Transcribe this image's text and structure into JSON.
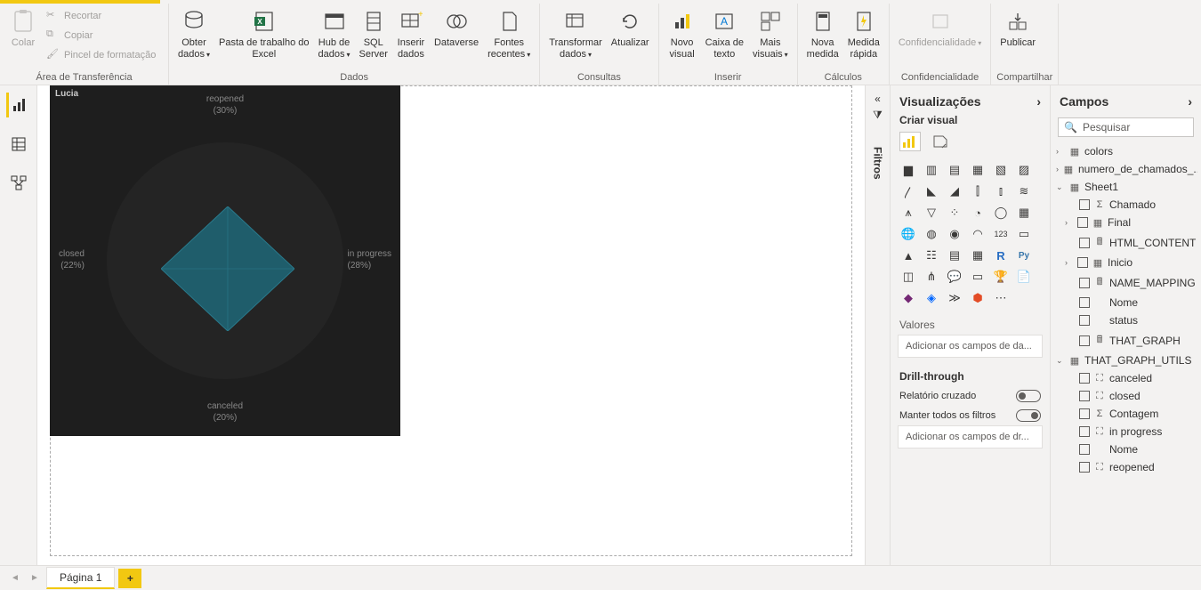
{
  "ribbon": {
    "clipboard": {
      "label": "Área de Transferência",
      "paste": "Colar",
      "cut": "Recortar",
      "copy": "Copiar",
      "format_painter": "Pincel de formatação"
    },
    "data": {
      "label": "Dados",
      "get_data": "Obter\ndados",
      "excel": "Pasta de trabalho do\nExcel",
      "hub": "Hub de\ndados",
      "sql": "SQL\nServer",
      "enter": "Inserir\ndados",
      "dataverse": "Dataverse",
      "recent": "Fontes\nrecentes"
    },
    "queries": {
      "label": "Consultas",
      "transform": "Transformar\ndados",
      "refresh": "Atualizar"
    },
    "insert": {
      "label": "Inserir",
      "new_visual": "Novo\nvisual",
      "text_box": "Caixa de\ntexto",
      "more_visuals": "Mais\nvisuais"
    },
    "calculations": {
      "label": "Cálculos",
      "new_measure": "Nova\nmedida",
      "quick_measure": "Medida\nrápida"
    },
    "sensitivity": {
      "label": "Confidencialidade",
      "btn": "Confidencialidade"
    },
    "share": {
      "label": "Compartilhar",
      "publish": "Publicar"
    }
  },
  "chart_data": {
    "type": "radar",
    "title": "Lucia",
    "categories": [
      "reopened",
      "in progress",
      "canceled",
      "closed"
    ],
    "values": [
      30,
      28,
      20,
      22
    ],
    "labels": {
      "top": "reopened\n(30%)",
      "right": "in progress\n(28%)",
      "bottom": "canceled\n(20%)",
      "left": "closed\n(22%)"
    },
    "bg": "#1e1e1e",
    "fill": "#1f5d6b"
  },
  "filters_pane": {
    "label": "Filtros"
  },
  "viz_pane": {
    "title": "Visualizações",
    "subtitle": "Criar visual",
    "values_label": "Valores",
    "values_placeholder": "Adicionar os campos de da...",
    "drill_label": "Drill-through",
    "cross_report": "Relatório cruzado",
    "keep_filters": "Manter todos os filtros",
    "drill_placeholder": "Adicionar os campos de dr..."
  },
  "fields_pane": {
    "title": "Campos",
    "search_placeholder": "Pesquisar",
    "tree": {
      "colors": "colors",
      "numero": "numero_de_chamados_...",
      "sheet1": "Sheet1",
      "chamado": "Chamado",
      "final": "Final",
      "html_content": "HTML_CONTENT",
      "inicio": "Inicio",
      "name_mapping": "NAME_MAPPING",
      "nome": "Nome",
      "status": "status",
      "that_graph": "THAT_GRAPH",
      "that_graph_utils": "THAT_GRAPH_UTILS",
      "canceled": "canceled",
      "closed": "closed",
      "contagem": "Contagem",
      "in_progress": "in progress",
      "nome2": "Nome",
      "reopened": "reopened"
    }
  },
  "page_tabs": {
    "page1": "Página 1"
  }
}
